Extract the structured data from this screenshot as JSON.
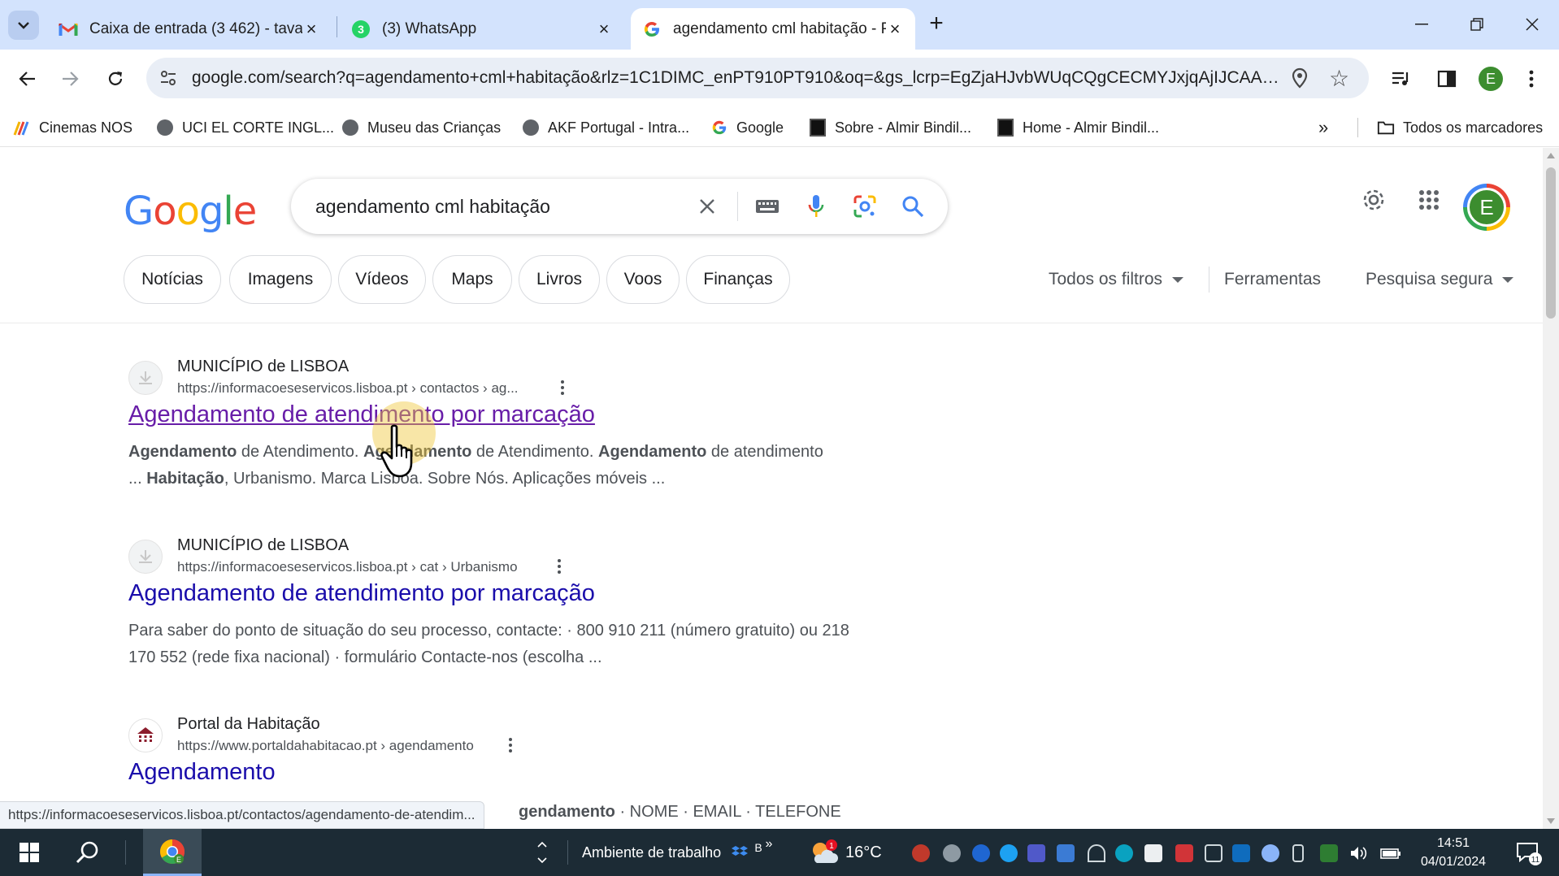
{
  "tabs": [
    {
      "title": "Caixa de entrada (3 462) - tavar",
      "icon": "gmail-icon"
    },
    {
      "title": "(3) WhatsApp",
      "icon": "whatsapp-icon",
      "badge": "3"
    },
    {
      "title": "agendamento cml habitação - P",
      "icon": "google-icon"
    }
  ],
  "toolbar": {
    "url": "google.com/search?q=agendamento+cml+habitação&rlz=1C1DIMC_enPT910PT910&oq=&gs_lcrp=EgZjaHJvbWUqCQgCECMYJxjqAjIJCAAQIx...",
    "profile_initial": "E"
  },
  "bookmarks": [
    {
      "label": "Cinemas NOS",
      "icon": "nos-icon"
    },
    {
      "label": "UCI EL CORTE INGL...",
      "icon": "globe-icon"
    },
    {
      "label": "Museu das Crianças",
      "icon": "globe-icon"
    },
    {
      "label": "AKF Portugal - Intra...",
      "icon": "globe-icon"
    },
    {
      "label": "Google",
      "icon": "google-icon"
    },
    {
      "label": "Sobre - Almir Bindil...",
      "icon": "site-icon"
    },
    {
      "label": "Home - Almir Bindil...",
      "icon": "site-icon"
    }
  ],
  "bookmarks_all": "Todos os marcadores",
  "search": {
    "query": "agendamento cml habitação",
    "logo": "Google",
    "avatar": "E"
  },
  "chips": [
    "Notícias",
    "Imagens",
    "Vídeos",
    "Maps",
    "Livros",
    "Voos",
    "Finanças"
  ],
  "filters": {
    "all": "Todos os filtros",
    "tools": "Ferramentas",
    "safe": "Pesquisa segura"
  },
  "results": [
    {
      "site": "MUNICÍPIO de LISBOA",
      "url": "https://informacoeseservicos.lisboa.pt › contactos › ag...",
      "title": "Agendamento de atendimento por marcação",
      "snippet_html": "<b>Agendamento</b> de Atendimento. <b>Agendamento</b> de Atendimento. <b>Agendamento</b> de atendimento<br>... <b>Habitação</b>, Urbanismo. Marca Lisboa. Sobre Nós. Aplicações móveis ..."
    },
    {
      "site": "MUNICÍPIO de LISBOA",
      "url": "https://informacoeseservicos.lisboa.pt › cat › Urbanismo",
      "title": "Agendamento de atendimento por marcação",
      "snippet": "Para saber do ponto de situação do seu processo, contacte: · 800 910 211 (número gratuito) ou 218 170 552 (rede fixa nacional) · formulário Contacte-nos (escolha ..."
    },
    {
      "site": "Portal da Habitação",
      "url": "https://www.portaldahabitacao.pt › agendamento",
      "title": "Agendamento",
      "snippet_tail_bold": "gendamento",
      "snippet_tail": " · NOME · EMAIL · TELEFONE"
    }
  ],
  "status_url": "https://informacoeseservicos.lisboa.pt/contactos/agendamento-de-atendim...",
  "taskbar": {
    "desktop_label": "Ambiente de trabalho",
    "desktop_suffix": "B",
    "weather": "16°C",
    "weather_badge": "1",
    "time": "14:51",
    "date": "04/01/2024",
    "notifications": "11"
  },
  "colors": {
    "tabstrip": "#d3e3fd",
    "link": "#1a0dab",
    "visited": "#681da8",
    "taskbar": "#1c2b35"
  }
}
